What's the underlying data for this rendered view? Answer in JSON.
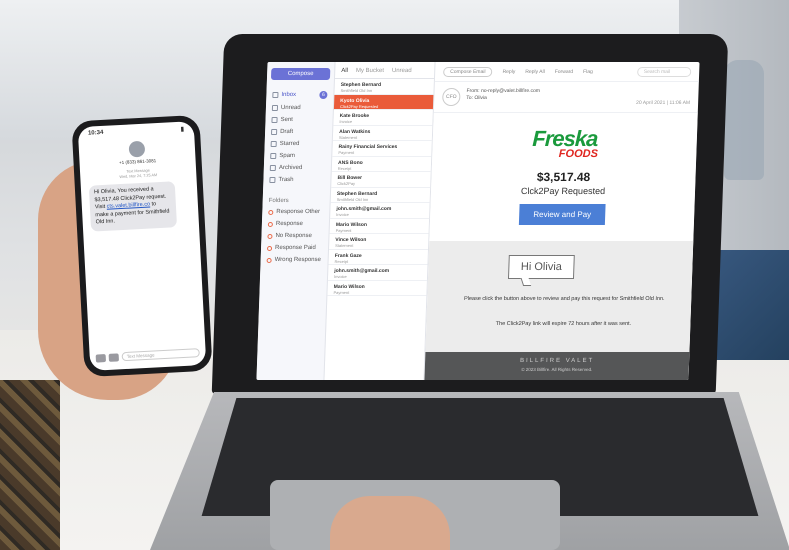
{
  "email_client": {
    "sidebar": {
      "compose_label": "Compose",
      "nav": [
        {
          "label": "Inbox",
          "badge": "6"
        },
        {
          "label": "Unread",
          "badge": ""
        },
        {
          "label": "Sent",
          "badge": ""
        },
        {
          "label": "Draft",
          "badge": ""
        },
        {
          "label": "Starred",
          "badge": ""
        },
        {
          "label": "Spam",
          "badge": ""
        },
        {
          "label": "Archived",
          "badge": ""
        },
        {
          "label": "Trash",
          "badge": ""
        }
      ],
      "folders_heading": "Folders",
      "folders": [
        {
          "label": "Response Other"
        },
        {
          "label": "Response"
        },
        {
          "label": "No Response"
        },
        {
          "label": "Response Paid"
        },
        {
          "label": "Wrong Response"
        }
      ]
    },
    "list_tabs": [
      "All",
      "My Bucket",
      "Unread"
    ],
    "messages": [
      {
        "sender": "Stephen Bernard",
        "preview": "Smithfield Old Inn"
      },
      {
        "sender": "Kyoto Olivia",
        "preview": "Click2Pay Requested"
      },
      {
        "sender": "Kate Brooke",
        "preview": "Invoice"
      },
      {
        "sender": "Alan Watkins",
        "preview": "Statement"
      },
      {
        "sender": "Rainy Financial Services",
        "preview": "Payment"
      },
      {
        "sender": "ANS Bono",
        "preview": "Receipt"
      },
      {
        "sender": "Bill Bower",
        "preview": "Click2Pay"
      },
      {
        "sender": "Stephen Bernard",
        "preview": "Smithfield Old Inn"
      },
      {
        "sender": "john.smith@gmail.com",
        "preview": "Invoice"
      },
      {
        "sender": "Mario Wilson",
        "preview": "Payment"
      },
      {
        "sender": "Vince Wilson",
        "preview": "Statement"
      },
      {
        "sender": "Frank Gaze",
        "preview": "Receipt"
      },
      {
        "sender": "john.smith@gmail.com",
        "preview": "Invoice"
      },
      {
        "sender": "Mario Wilson",
        "preview": "Payment"
      }
    ],
    "toolbar": {
      "compose_email": "Compose Email",
      "reply": "Reply",
      "reply_all": "Reply All",
      "forward": "Forward",
      "flag": "Flag",
      "search_placeholder": "Search mail"
    },
    "header": {
      "avatar": "CFO",
      "from": "From: no-reply@valet.billfire.com",
      "to": "To: Olivia",
      "date": "20 April 2021 | 11:06 AM"
    },
    "mail": {
      "brand": "Freska",
      "brand_sub": "FOODS",
      "amount": "$3,517.48",
      "request": "Clck2Pay Requested",
      "button": "Review and Pay",
      "greeting": "Hi Olivia",
      "body1": "Please click the button above to review and pay this request for Smithfield Old Inn.",
      "body2": "The Click2Pay link will expire 72 hours after it was sent.",
      "footer_brand": "BILLFIRE VALET",
      "footer_copy": "© 2023 Billfire. All Rights Reserved."
    }
  },
  "phone": {
    "time": "10:34",
    "number": "+1 (833) 861-3081",
    "meta_line1": "Text Message",
    "meta_line2": "Wed, Mar 24, 7:25 AM",
    "message_prefix": "Hi Olivia, You received a $3,517.48 Click2Pay request. Visit ",
    "message_link": "cts.valet.billfire.co",
    "message_suffix": " to make a payment for Smithfield Old Inn.",
    "input_placeholder": "Text Message"
  }
}
